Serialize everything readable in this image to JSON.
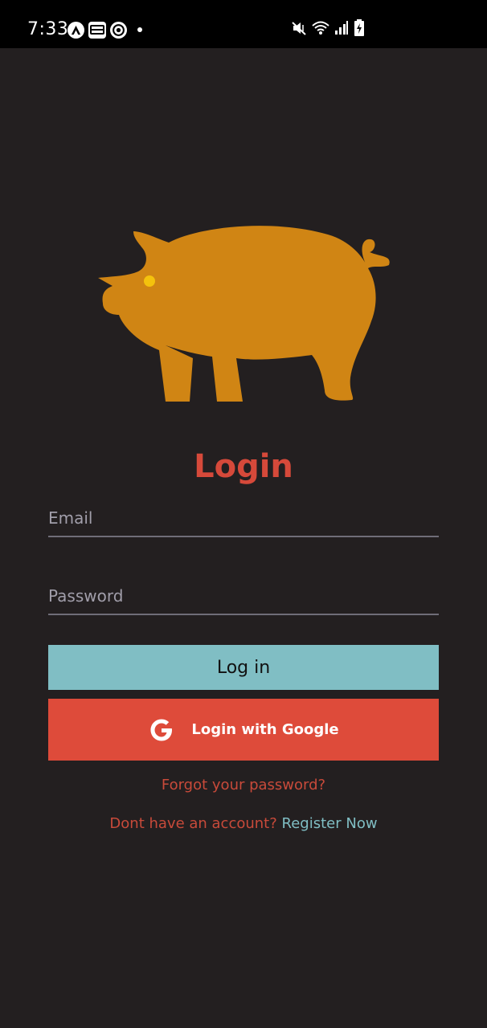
{
  "status_bar": {
    "time": "7:33",
    "left_icons": [
      "a-icon",
      "webtoon-icon",
      "app-icon",
      "dot-icon"
    ],
    "right_icons": [
      "mute-icon",
      "wifi-icon",
      "signal-icon",
      "battery-icon"
    ],
    "webtoon_label": "WEB\nTOON",
    "a_label": "A"
  },
  "logo": {
    "icon": "pig-icon",
    "color": "#d08514",
    "eye_color": "#f4c20d"
  },
  "login": {
    "title": "Login",
    "email_placeholder": "Email",
    "password_placeholder": "Password",
    "login_button": "Log in",
    "google_button": "Login with Google",
    "forgot_password": "Forgot your password?",
    "register_prompt": "Dont have an account?",
    "register_link": "Register Now"
  },
  "colors": {
    "background": "#231f20",
    "title": "#d6493a",
    "login_button": "#80bec4",
    "google_button": "#de4b3a",
    "link": "#80bec4"
  }
}
